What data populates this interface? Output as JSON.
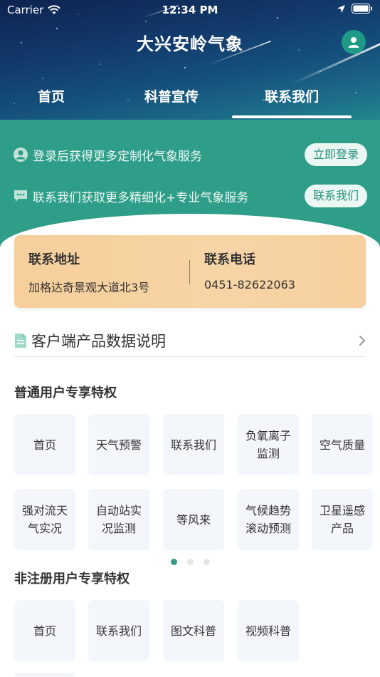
{
  "status": {
    "carrier": "Carrier",
    "time": "12:34 PM"
  },
  "header": {
    "title": "大兴安岭气象"
  },
  "tabs": [
    {
      "label": "首页"
    },
    {
      "label": "科普宣传"
    },
    {
      "label": "联系我们"
    }
  ],
  "promos": [
    {
      "text": "登录后获得更多定制化气象服务",
      "button": "立即登录",
      "icon": "user-circle-icon"
    },
    {
      "text": "联系我们获取更多精细化+专业气象服务",
      "button": "联系我们",
      "icon": "chat-bubble-icon"
    }
  ],
  "contact": {
    "address_label": "联系地址",
    "address_value": "加格达奇景观大道北3号",
    "phone_label": "联系电话",
    "phone_value": "0451-82622063"
  },
  "product_info": {
    "label": "客户端产品数据说明"
  },
  "normal_section": {
    "title": "普通用户专享特权",
    "items": [
      "首页",
      "天气预警",
      "联系我们",
      "负氧离子监测",
      "空气质量",
      "强对流天气实况",
      "自动站实况监测",
      "等风来",
      "气候趋势滚动预测",
      "卫星遥感产品"
    ]
  },
  "pager": {
    "pages": 3,
    "active": 1
  },
  "unregistered_section": {
    "title": "非注册用户专享特权",
    "items": [
      "首页",
      "联系我们",
      "图文科普",
      "视频科普"
    ]
  },
  "colors": {
    "accent": "#2e9e88",
    "card": "#f6cf9b",
    "tile": "#f3f6fb"
  }
}
